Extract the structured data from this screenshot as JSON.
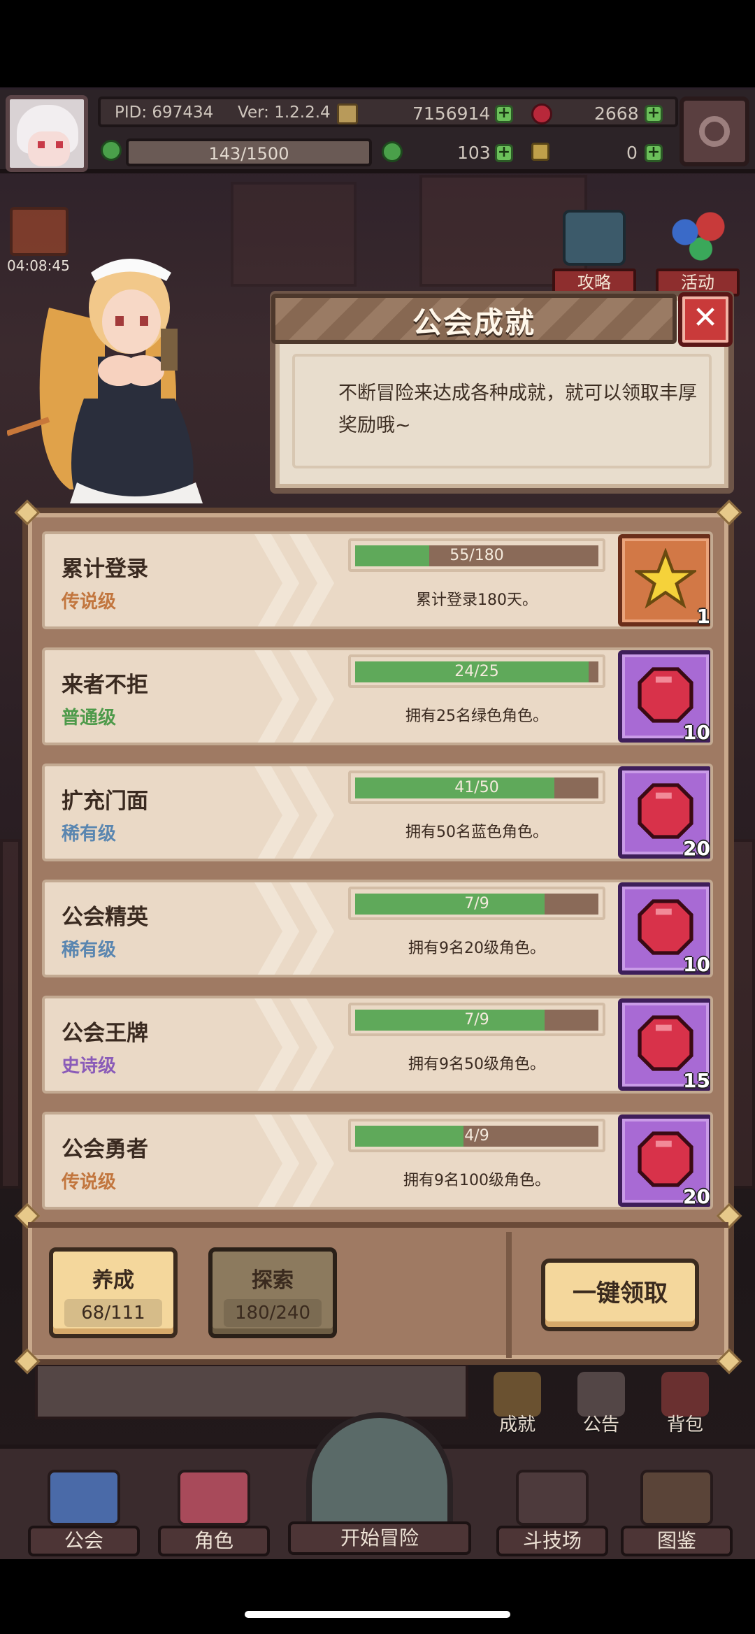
{
  "hud": {
    "pid": "PID: 697434",
    "version": "Ver: 1.2.2.4",
    "gold": "7156914",
    "gems": "2668",
    "exp": "143/1500",
    "clover": "103",
    "key": "0"
  },
  "timer": "04:08:45",
  "side_buttons": {
    "guide": "攻略",
    "event": "活动"
  },
  "dialog": {
    "title": "公会成就",
    "description": "不断冒险来达成各种成就，就可以领取丰厚奖励哦~"
  },
  "achievements": [
    {
      "name": "累计登录",
      "tier": "传说级",
      "tier_color": "#c2763e",
      "progress_text": "55/180",
      "progress": 0.306,
      "goal": "累计登录180天。",
      "reward_type": "star",
      "reward_count": "1"
    },
    {
      "name": "来者不拒",
      "tier": "普通级",
      "tier_color": "#4e9a4a",
      "progress_text": "24/25",
      "progress": 0.96,
      "goal": "拥有25名绿色角色。",
      "reward_type": "gem",
      "reward_count": "10"
    },
    {
      "name": "扩充门面",
      "tier": "稀有级",
      "tier_color": "#5a86b0",
      "progress_text": "41/50",
      "progress": 0.82,
      "goal": "拥有50名蓝色角色。",
      "reward_type": "gem",
      "reward_count": "20"
    },
    {
      "name": "公会精英",
      "tier": "稀有级",
      "tier_color": "#5a86b0",
      "progress_text": "7/9",
      "progress": 0.778,
      "goal": "拥有9名20级角色。",
      "reward_type": "gem",
      "reward_count": "10"
    },
    {
      "name": "公会王牌",
      "tier": "史诗级",
      "tier_color": "#8a5bb8",
      "progress_text": "7/9",
      "progress": 0.778,
      "goal": "拥有9名50级角色。",
      "reward_type": "gem",
      "reward_count": "15"
    },
    {
      "name": "公会勇者",
      "tier": "传说级",
      "tier_color": "#c2763e",
      "progress_text": "4/9",
      "progress": 0.444,
      "goal": "拥有9名100级角色。",
      "reward_type": "gem",
      "reward_count": "20"
    }
  ],
  "tabs": [
    {
      "label": "养成",
      "count": "68/111",
      "active": true
    },
    {
      "label": "探索",
      "count": "180/240",
      "active": false
    }
  ],
  "claim_all": "一键领取",
  "mini_buttons": {
    "achievement": "成就",
    "notice": "公告",
    "bag": "背包"
  },
  "nav": {
    "guild": "公会",
    "character": "角色",
    "adventure": "开始冒险",
    "arena": "斗技场",
    "codex": "图鉴"
  }
}
